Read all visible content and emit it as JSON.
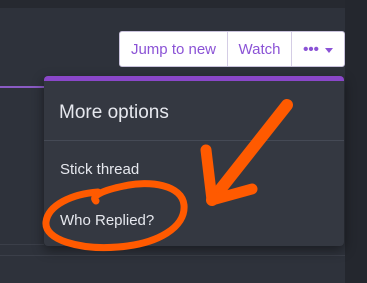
{
  "toolbar": {
    "jump_label": "Jump to new",
    "watch_label": "Watch",
    "more_glyph": "•••"
  },
  "menu": {
    "title": "More options",
    "items": [
      {
        "label": "Stick thread"
      },
      {
        "label": "Who Replied?"
      }
    ]
  },
  "colors": {
    "accent": "#8a47c9",
    "button_text": "#8b53d6",
    "annotation": "#ff5a00",
    "menu_bg": "#343841"
  },
  "icons": [
    "more-dots-icon",
    "caret-down-icon",
    "arrow-annotation-icon",
    "circle-annotation-icon"
  ]
}
